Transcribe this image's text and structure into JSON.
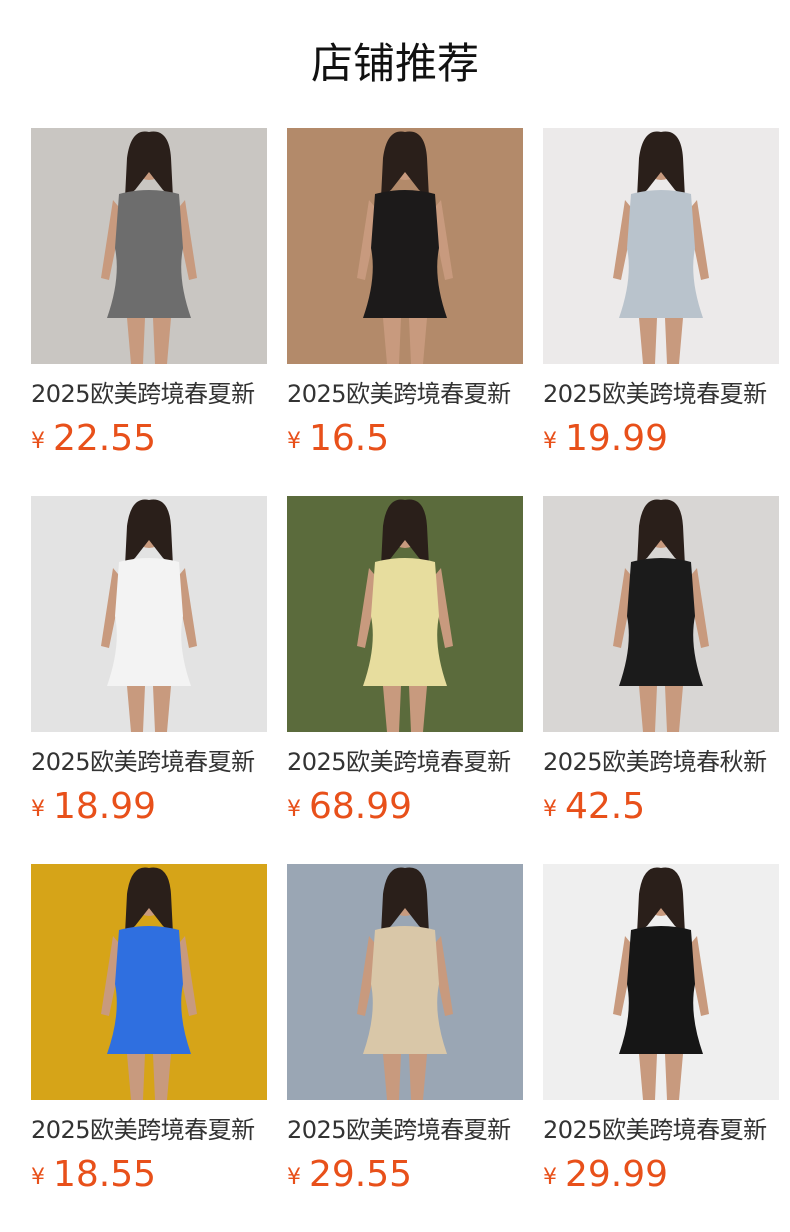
{
  "page": {
    "title": "店铺推荐"
  },
  "currency_symbol": "¥",
  "products": [
    {
      "title": "2025欧美跨境春夏新",
      "price": "22.55",
      "image": "gray-polo-dress-photo",
      "bg": "#c9c6c2",
      "garment": "#6d6d6d"
    },
    {
      "title": "2025欧美跨境春夏新",
      "price": "16.5",
      "image": "black-long-sleeve-dress-photo",
      "bg": "#b38a6a",
      "garment": "#1c1a1a"
    },
    {
      "title": "2025欧美跨境春夏新",
      "price": "19.99",
      "image": "striped-tube-dress-photo",
      "bg": "#eceaea",
      "garment": "#b9c3cc"
    },
    {
      "title": "2025欧美跨境春夏新",
      "price": "18.99",
      "image": "white-halter-dress-photo",
      "bg": "#e3e3e3",
      "garment": "#f3f3f3"
    },
    {
      "title": "2025欧美跨境春夏新",
      "price": "68.99",
      "image": "yellow-satin-dress-photo",
      "bg": "#5b6b3c",
      "garment": "#e7dd9e"
    },
    {
      "title": "2025欧美跨境春秋新",
      "price": "42.5",
      "image": "black-romper-photo",
      "bg": "#d8d6d4",
      "garment": "#1b1b1b"
    },
    {
      "title": "2025欧美跨境春夏新",
      "price": "18.55",
      "image": "blue-tube-dress-photo",
      "bg": "#d6a418",
      "garment": "#2f6fe0"
    },
    {
      "title": "2025欧美跨境春夏新",
      "price": "29.55",
      "image": "beige-off-shoulder-dress-photo",
      "bg": "#9aa6b4",
      "garment": "#d9c7a8"
    },
    {
      "title": "2025欧美跨境春夏新",
      "price": "29.99",
      "image": "black-halter-mini-dress-photo",
      "bg": "#efefef",
      "garment": "#161616"
    }
  ]
}
